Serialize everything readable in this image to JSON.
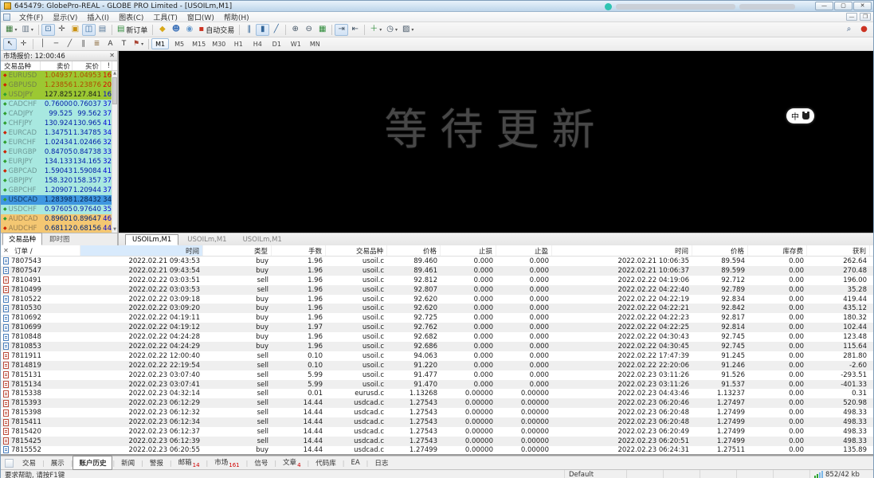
{
  "window": {
    "title": "645479: GlobePro-REAL - GLOBE PRO Limited - [USOILm,M1]"
  },
  "menu": {
    "items": [
      "文件(F)",
      "显示(V)",
      "插入(I)",
      "图表(C)",
      "工具(T)",
      "窗口(W)",
      "帮助(H)"
    ]
  },
  "toolbar": {
    "row1": [
      {
        "n": "new-chart",
        "g": "▦",
        "c": "#3a7a3a",
        "caret": true
      },
      {
        "n": "profiles",
        "g": "▥",
        "c": "#6a7a8a",
        "caret": true
      },
      {
        "sep": true
      },
      {
        "n": "cursor-mode",
        "g": "⊡",
        "c": "#3a6a9a",
        "pressed": true
      },
      {
        "n": "crosshair-mode",
        "g": "✛",
        "c": "#555555"
      },
      {
        "n": "favorites",
        "g": "▣",
        "c": "#c89010"
      },
      {
        "n": "market-watch-toggle",
        "g": "◫",
        "c": "#336699",
        "pressed": true
      },
      {
        "n": "data-window-toggle",
        "g": "▤",
        "c": "#557799"
      },
      {
        "sep": true
      },
      {
        "n": "new-order",
        "g": "▤",
        "c": "#2e8b3a",
        "label": "新订单"
      },
      {
        "sep": true
      },
      {
        "n": "quotes",
        "g": "◆",
        "c": "#d8a818"
      },
      {
        "n": "accounts",
        "g": "☻",
        "c": "#4477bb"
      },
      {
        "n": "web",
        "g": "◉",
        "c": "#6699cc"
      },
      {
        "n": "autotrading",
        "g": "▪",
        "c": "#cc3322",
        "label": "自动交易"
      },
      {
        "sep": true
      },
      {
        "n": "bar-chart",
        "g": "‖",
        "c": "#336699"
      },
      {
        "n": "candlestick-chart",
        "g": "▮",
        "c": "#336699",
        "pressed": true
      },
      {
        "n": "line-chart",
        "g": "╱",
        "c": "#336699"
      },
      {
        "sep": true
      },
      {
        "n": "zoom-in",
        "g": "⊕",
        "c": "#445566"
      },
      {
        "n": "zoom-out",
        "g": "⊖",
        "c": "#445566"
      },
      {
        "n": "tile-windows",
        "g": "▦",
        "c": "#2e8b3a"
      },
      {
        "sep": true
      },
      {
        "n": "auto-scroll",
        "g": "⇥",
        "c": "#445566",
        "pressed": true
      },
      {
        "n": "chart-shift",
        "g": "⇤",
        "c": "#445566"
      },
      {
        "sep": true
      },
      {
        "n": "indicators",
        "g": "＋",
        "c": "#2e8b3a",
        "caret": true
      },
      {
        "n": "periods-list",
        "g": "◷",
        "c": "#445566",
        "caret": true
      },
      {
        "n": "templates",
        "g": "▨",
        "c": "#445566",
        "caret": true
      }
    ],
    "row1_right": [
      {
        "n": "search",
        "g": "⌕",
        "c": "#33557f"
      },
      {
        "n": "help",
        "g": "●",
        "c": "#cc3322"
      }
    ],
    "row2": [
      {
        "n": "pointer",
        "g": "↖",
        "c": "#222222",
        "pressed": true
      },
      {
        "n": "crosshair-tool",
        "g": "✛",
        "c": "#444444"
      },
      {
        "sep": true
      },
      {
        "n": "vertical-line",
        "g": "│",
        "c": "#444444"
      },
      {
        "n": "horizontal-line",
        "g": "─",
        "c": "#444444"
      },
      {
        "n": "trendline",
        "g": "╱",
        "c": "#444444"
      },
      {
        "n": "equidistant-channel",
        "g": "∥",
        "c": "#444444"
      },
      {
        "n": "fibonacci",
        "g": "≣",
        "c": "#8a6a3a"
      },
      {
        "n": "text",
        "g": "A",
        "c": "#333333"
      },
      {
        "n": "text-label",
        "g": "T",
        "c": "#333333"
      },
      {
        "n": "arrows",
        "g": "⚑",
        "c": "#aa4433",
        "caret": true
      },
      {
        "sep": true
      }
    ],
    "timeframes": [
      "M1",
      "M5",
      "M15",
      "M30",
      "H1",
      "H4",
      "D1",
      "W1",
      "MN"
    ],
    "active_timeframe": "M1"
  },
  "market_watch": {
    "title": "市场报价: 12:00:46",
    "columns": [
      "交易品种",
      "卖价",
      "买价",
      "!"
    ],
    "rows": [
      {
        "sym": "EURUSD",
        "bid": "1.04937",
        "ask": "1.04953",
        "spread": "16",
        "bg": "green-hot",
        "icon": "red-diamond"
      },
      {
        "sym": "GBPUSD",
        "bid": "1.23856",
        "ask": "1.23876",
        "spread": "20",
        "bg": "green-hot",
        "icon": "red-diamond"
      },
      {
        "sym": "USDJPY",
        "bid": "127.825",
        "ask": "127.841",
        "spread": "16",
        "bg": "green",
        "icon": "green-diamond"
      },
      {
        "sym": "CADCHF",
        "bid": "0.76000",
        "ask": "0.76037",
        "spread": "37",
        "bg": "cyan",
        "icon": "green-diamond"
      },
      {
        "sym": "CADJPY",
        "bid": "99.525",
        "ask": "99.562",
        "spread": "37",
        "bg": "cyan",
        "icon": "green-diamond"
      },
      {
        "sym": "CHFJPY",
        "bid": "130.924",
        "ask": "130.965",
        "spread": "41",
        "bg": "cyan",
        "icon": "green-diamond"
      },
      {
        "sym": "EURCAD",
        "bid": "1.34751",
        "ask": "1.34785",
        "spread": "34",
        "bg": "cyan",
        "icon": "red-diamond"
      },
      {
        "sym": "EURCHF",
        "bid": "1.02434",
        "ask": "1.02466",
        "spread": "32",
        "bg": "cyan",
        "icon": "green-diamond"
      },
      {
        "sym": "EURGBP",
        "bid": "0.84705",
        "ask": "0.84738",
        "spread": "33",
        "bg": "cyan",
        "icon": "red-diamond"
      },
      {
        "sym": "EURJPY",
        "bid": "134.133",
        "ask": "134.165",
        "spread": "32",
        "bg": "cyan",
        "icon": "green-diamond"
      },
      {
        "sym": "GBPCAD",
        "bid": "1.59043",
        "ask": "1.59084",
        "spread": "41",
        "bg": "cyan",
        "icon": "red-diamond"
      },
      {
        "sym": "GBPJPY",
        "bid": "158.320",
        "ask": "158.357",
        "spread": "37",
        "bg": "cyan",
        "icon": "green-diamond"
      },
      {
        "sym": "GBPCHF",
        "bid": "1.20907",
        "ask": "1.20944",
        "spread": "37",
        "bg": "cyan",
        "icon": "green-diamond"
      },
      {
        "sym": "USDCAD",
        "bid": "1.28398",
        "ask": "1.28432",
        "spread": "34",
        "bg": "selected",
        "icon": "green-diamond"
      },
      {
        "sym": "USDCHF",
        "bid": "0.97605",
        "ask": "0.97640",
        "spread": "35",
        "bg": "cyan",
        "icon": "green-diamond"
      },
      {
        "sym": "AUDCAD",
        "bid": "0.89601",
        "ask": "0.89647",
        "spread": "46",
        "bg": "orange",
        "icon": "green-diamond"
      },
      {
        "sym": "AUDCHF",
        "bid": "0.68112",
        "ask": "0.68156",
        "spread": "44",
        "bg": "orange",
        "icon": "red-diamond"
      }
    ],
    "tabs": [
      "交易品种",
      "即时图"
    ],
    "active_tab": "交易品种"
  },
  "chart": {
    "watermark": "等待更新",
    "badge": "中",
    "tabs": [
      {
        "label": "USOILm,M1",
        "active": true
      },
      {
        "label": "USOILm,M1",
        "active": false
      },
      {
        "label": "USOILm,M1",
        "active": false
      }
    ]
  },
  "history": {
    "columns": [
      "订单 /",
      "时间",
      "类型",
      "手数",
      "交易品种",
      "价格",
      "止损",
      "止盈",
      "时间",
      "价格",
      "库存费",
      "获利"
    ],
    "sorted_column_index": 1,
    "rows": [
      [
        "7807543",
        "2022.02.21 09:43:53",
        "buy",
        "1.96",
        "usoil.c",
        "89.460",
        "0.000",
        "0.000",
        "2022.02.21 10:06:35",
        "89.594",
        "0.00",
        "262.64"
      ],
      [
        "7807547",
        "2022.02.21 09:43:54",
        "buy",
        "1.96",
        "usoil.c",
        "89.461",
        "0.000",
        "0.000",
        "2022.02.21 10:06:37",
        "89.599",
        "0.00",
        "270.48"
      ],
      [
        "7810491",
        "2022.02.22 03:03:51",
        "sell",
        "1.96",
        "usoil.c",
        "92.812",
        "0.000",
        "0.000",
        "2022.02.22 04:19:06",
        "92.712",
        "0.00",
        "196.00"
      ],
      [
        "7810499",
        "2022.02.22 03:03:53",
        "sell",
        "1.96",
        "usoil.c",
        "92.807",
        "0.000",
        "0.000",
        "2022.02.22 04:22:40",
        "92.789",
        "0.00",
        "35.28"
      ],
      [
        "7810522",
        "2022.02.22 03:09:18",
        "buy",
        "1.96",
        "usoil.c",
        "92.620",
        "0.000",
        "0.000",
        "2022.02.22 04:22:19",
        "92.834",
        "0.00",
        "419.44"
      ],
      [
        "7810530",
        "2022.02.22 03:09:20",
        "buy",
        "1.96",
        "usoil.c",
        "92.620",
        "0.000",
        "0.000",
        "2022.02.22 04:22:21",
        "92.842",
        "0.00",
        "435.12"
      ],
      [
        "7810692",
        "2022.02.22 04:19:11",
        "buy",
        "1.96",
        "usoil.c",
        "92.725",
        "0.000",
        "0.000",
        "2022.02.22 04:22:23",
        "92.817",
        "0.00",
        "180.32"
      ],
      [
        "7810699",
        "2022.02.22 04:19:12",
        "buy",
        "1.97",
        "usoil.c",
        "92.762",
        "0.000",
        "0.000",
        "2022.02.22 04:22:25",
        "92.814",
        "0.00",
        "102.44"
      ],
      [
        "7810848",
        "2022.02.22 04:24:28",
        "buy",
        "1.96",
        "usoil.c",
        "92.682",
        "0.000",
        "0.000",
        "2022.02.22 04:30:43",
        "92.745",
        "0.00",
        "123.48"
      ],
      [
        "7810853",
        "2022.02.22 04:24:29",
        "buy",
        "1.96",
        "usoil.c",
        "92.686",
        "0.000",
        "0.000",
        "2022.02.22 04:30:45",
        "92.745",
        "0.00",
        "115.64"
      ],
      [
        "7811911",
        "2022.02.22 12:00:40",
        "sell",
        "0.10",
        "usoil.c",
        "94.063",
        "0.000",
        "0.000",
        "2022.02.22 17:47:39",
        "91.245",
        "0.00",
        "281.80"
      ],
      [
        "7814819",
        "2022.02.22 22:19:54",
        "sell",
        "0.10",
        "usoil.c",
        "91.220",
        "0.000",
        "0.000",
        "2022.02.22 22:20:06",
        "91.246",
        "0.00",
        "-2.60"
      ],
      [
        "7815131",
        "2022.02.23 03:07:40",
        "sell",
        "5.99",
        "usoil.c",
        "91.477",
        "0.000",
        "0.000",
        "2022.02.23 03:11:26",
        "91.526",
        "0.00",
        "-293.51"
      ],
      [
        "7815134",
        "2022.02.23 03:07:41",
        "sell",
        "5.99",
        "usoil.c",
        "91.470",
        "0.000",
        "0.000",
        "2022.02.23 03:11:26",
        "91.537",
        "0.00",
        "-401.33"
      ],
      [
        "7815338",
        "2022.02.23 04:32:14",
        "sell",
        "0.01",
        "eurusd.c",
        "1.13268",
        "0.00000",
        "0.00000",
        "2022.02.23 04:43:46",
        "1.13237",
        "0.00",
        "0.31"
      ],
      [
        "7815393",
        "2022.02.23 06:12:29",
        "sell",
        "14.44",
        "usdcad.c",
        "1.27543",
        "0.00000",
        "0.00000",
        "2022.02.23 06:20:46",
        "1.27497",
        "0.00",
        "520.98"
      ],
      [
        "7815398",
        "2022.02.23 06:12:32",
        "sell",
        "14.44",
        "usdcad.c",
        "1.27543",
        "0.00000",
        "0.00000",
        "2022.02.23 06:20:48",
        "1.27499",
        "0.00",
        "498.33"
      ],
      [
        "7815411",
        "2022.02.23 06:12:34",
        "sell",
        "14.44",
        "usdcad.c",
        "1.27543",
        "0.00000",
        "0.00000",
        "2022.02.23 06:20:48",
        "1.27499",
        "0.00",
        "498.33"
      ],
      [
        "7815420",
        "2022.02.23 06:12:37",
        "sell",
        "14.44",
        "usdcad.c",
        "1.27543",
        "0.00000",
        "0.00000",
        "2022.02.23 06:20:49",
        "1.27499",
        "0.00",
        "498.33"
      ],
      [
        "7815425",
        "2022.02.23 06:12:39",
        "sell",
        "14.44",
        "usdcad.c",
        "1.27543",
        "0.00000",
        "0.00000",
        "2022.02.23 06:20:51",
        "1.27499",
        "0.00",
        "498.33"
      ],
      [
        "7815552",
        "2022.02.23 06:20:55",
        "buy",
        "14.44",
        "usdcad.c",
        "1.27499",
        "0.00000",
        "0.00000",
        "2022.02.23 06:24:31",
        "1.27511",
        "0.00",
        "135.89"
      ]
    ]
  },
  "terminal_tabs": [
    {
      "label": "交易"
    },
    {
      "label": "展示"
    },
    {
      "label": "账户历史",
      "active": true
    },
    {
      "label": "新闻"
    },
    {
      "label": "警报"
    },
    {
      "label": "邮箱",
      "badge": "14"
    },
    {
      "label": "市场",
      "badge": "161"
    },
    {
      "label": "信号"
    },
    {
      "label": "文章",
      "badge": "4"
    },
    {
      "label": "代码库"
    },
    {
      "label": "EA"
    },
    {
      "label": "日志"
    }
  ],
  "status_bar": {
    "help": "要求帮助, 请按F1键",
    "profile": "Default",
    "traffic": "852/42 kb"
  },
  "colors": {
    "row_green": "#9cc832",
    "row_cyan": "#a8e8e0",
    "row_selected": "#3f97e0",
    "row_orange": "#f4c772",
    "hot_price": "#b04a00",
    "alert_red": "#e00000",
    "alert_blue": "#0000d8",
    "sorted_header": "#d8eafc",
    "buy_icon": "#4a7ebb",
    "sell_icon": "#bb4a3a",
    "watermark_gray": "#474747"
  }
}
